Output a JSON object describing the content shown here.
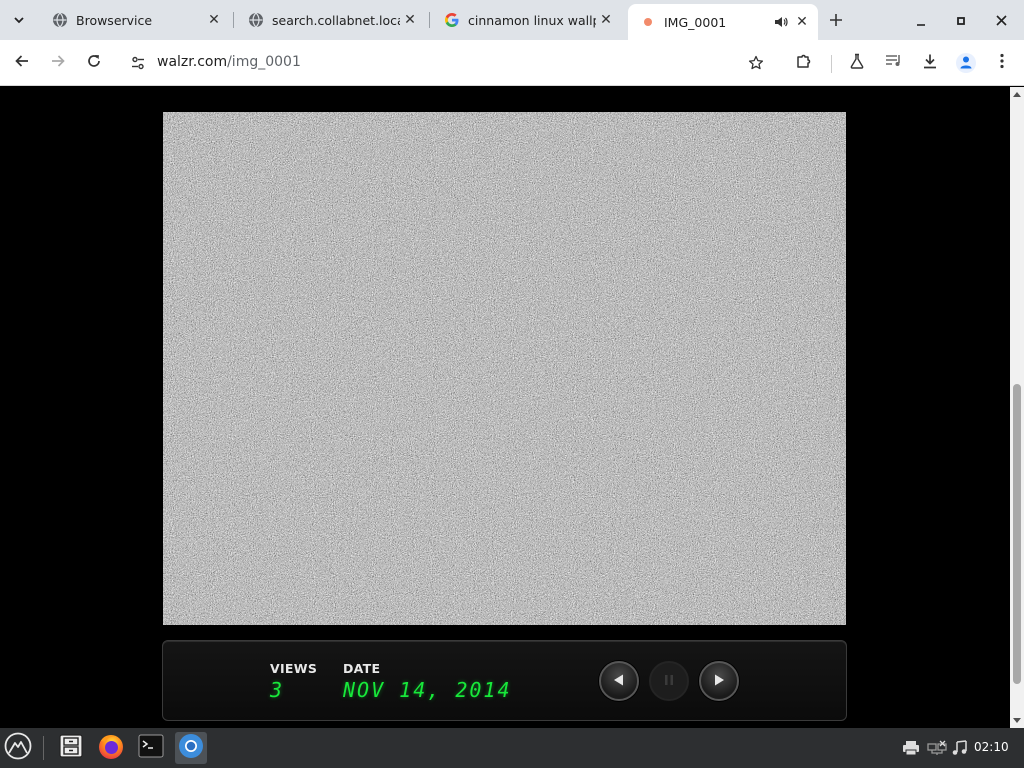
{
  "browser": {
    "tabs": [
      {
        "title": "Browservice",
        "icon": "globe-icon",
        "active": false
      },
      {
        "title": "search.collabnet.local",
        "icon": "globe-icon",
        "active": false
      },
      {
        "title": "cinnamon linux wallp",
        "icon": "google-g-icon",
        "active": false
      },
      {
        "title": "IMG_0001",
        "icon": "recording-dot-icon",
        "active": true,
        "audio": true
      }
    ],
    "address_bar": {
      "domain": "walzr.com",
      "path": "/img_0001"
    },
    "toolbar_icons": [
      "back-icon",
      "forward-icon",
      "reload-icon",
      "site-info-icon",
      "bookmark-star-icon",
      "extensions-icon",
      "labs-flask-icon",
      "media-controls-icon",
      "downloads-icon",
      "profile-icon",
      "menu-icon"
    ]
  },
  "page": {
    "views_label": "VIEWS",
    "views_value": "3",
    "date_label": "DATE",
    "date_value": "NOV 14, 2014",
    "accent_color": "#17e93a",
    "controls": [
      "previous",
      "pause",
      "next"
    ],
    "pause_enabled": false
  },
  "taskbar": {
    "apps": [
      "menu-icon",
      "file-manager-icon",
      "firefox-icon",
      "terminal-icon",
      "chromium-icon"
    ],
    "tray": [
      "printer-icon",
      "network-icon",
      "audio-icon"
    ],
    "clock": "02:10"
  }
}
